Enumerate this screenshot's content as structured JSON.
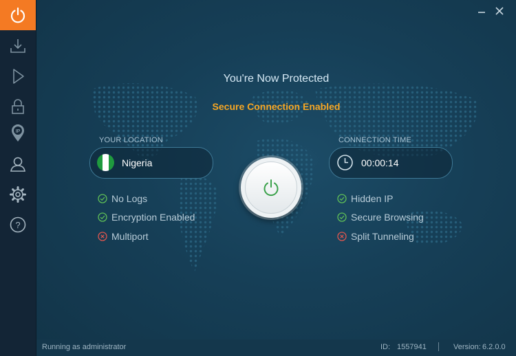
{
  "sidebar": {
    "items": [
      {
        "icon": "power-icon",
        "active": true
      },
      {
        "icon": "download-icon"
      },
      {
        "icon": "play-icon"
      },
      {
        "icon": "lock-icon"
      },
      {
        "icon": "ip-pin-icon",
        "label": "IP"
      },
      {
        "icon": "user-icon"
      },
      {
        "icon": "gear-icon"
      },
      {
        "icon": "help-icon",
        "label": "?"
      }
    ]
  },
  "window": {
    "minimize_icon": "minimize-icon",
    "close_icon": "close-icon"
  },
  "main": {
    "title": "You're Now Protected",
    "subtitle": "Secure Connection Enabled",
    "location": {
      "label": "YOUR LOCATION",
      "value": "Nigeria"
    },
    "connection_time": {
      "label": "CONNECTION TIME",
      "value": "00:00:14"
    },
    "left_features": [
      {
        "label": "No Logs",
        "status": "enabled"
      },
      {
        "label": "Encryption Enabled",
        "status": "enabled"
      },
      {
        "label": "Multiport",
        "status": "disabled"
      }
    ],
    "right_features": [
      {
        "label": "Hidden IP",
        "status": "enabled"
      },
      {
        "label": "Secure Browsing",
        "status": "enabled"
      },
      {
        "label": "Split Tunneling",
        "status": "disabled"
      }
    ]
  },
  "status_bar": {
    "running": "Running as administrator",
    "id_label": "ID:",
    "id_value": "1557941",
    "version_label": "Version:",
    "version_value": "6.2.0.0"
  },
  "colors": {
    "accent": "#f47a23",
    "subtitle": "#f6a623",
    "enabled": "#5fbf57",
    "disabled": "#e0564f",
    "background": "#163f57"
  }
}
